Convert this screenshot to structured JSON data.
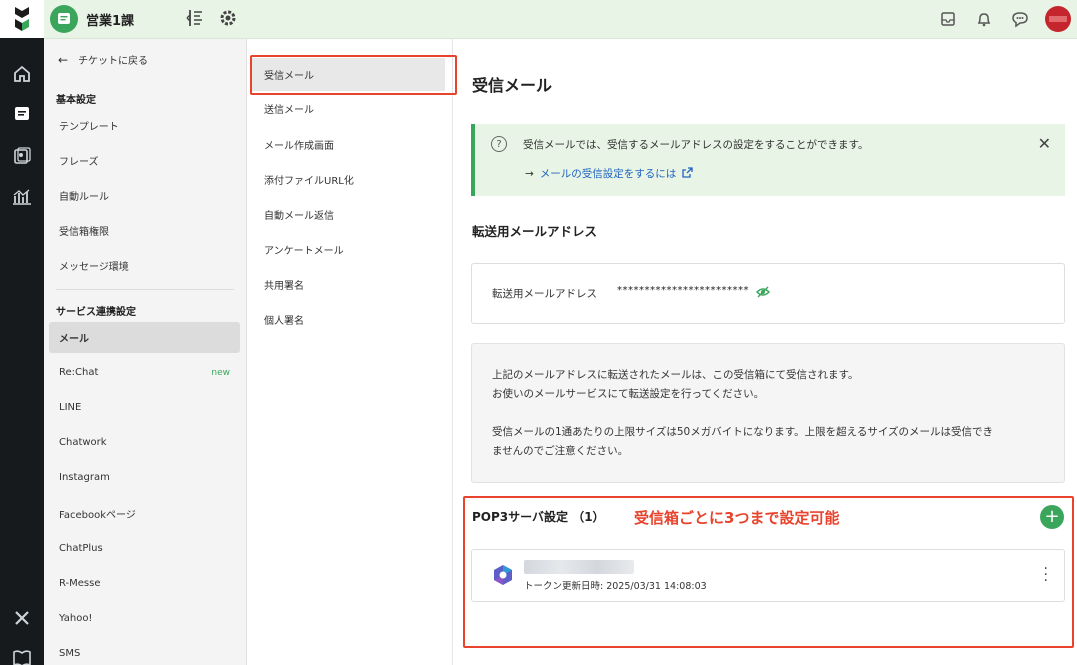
{
  "topbar": {
    "team_name": "営業1課"
  },
  "sidebar": {
    "back_label": "チケットに戻る",
    "section_basic": "基本設定",
    "basic_items": [
      "テンプレート",
      "フレーズ",
      "自動ルール",
      "受信箱権限",
      "メッセージ環境"
    ],
    "section_service": "サービス連携設定",
    "service_items": [
      {
        "label": "メール",
        "active": true
      },
      {
        "label": "Re:Chat",
        "badge": "new"
      },
      {
        "label": "LINE"
      },
      {
        "label": "Chatwork"
      },
      {
        "label": "Instagram"
      },
      {
        "label": "Facebookページ"
      },
      {
        "label": "ChatPlus"
      },
      {
        "label": "R-Messe"
      },
      {
        "label": "Yahoo!"
      },
      {
        "label": "SMS"
      }
    ]
  },
  "menu": {
    "items": [
      "受信メール",
      "送信メール",
      "メール作成画面",
      "添付ファイルURL化",
      "自動メール返信",
      "アンケートメール",
      "共用署名",
      "個人署名"
    ],
    "active_index": 0
  },
  "main": {
    "title": "受信メール",
    "info_text": "受信メールでは、受信するメールアドレスの設定をすることができます。",
    "info_link": "メールの受信設定をするには",
    "forward_title": "転送用メールアドレス",
    "forward_label": "転送用メールアドレス",
    "forward_value": "************************",
    "note_line1": "上記のメールアドレスに転送されたメールは、この受信箱にて受信されます。",
    "note_line2": "お使いのメールサービスにて転送設定を行ってください。",
    "note_line3": "受信メールの1通あたりの上限サイズは50メガバイトになります。上限を超えるサイズのメールは受信でき",
    "note_line4": "ませんのでご注意ください。",
    "pop_title": "POP3サーバ設定 （1）",
    "annotation": "受信箱ごとに3つまで設定可能",
    "card_timestamp": "トークン更新日時: 2025/03/31 14:08:03"
  },
  "colors": {
    "accent": "#3aa55b",
    "annotation": "#e8432c"
  }
}
